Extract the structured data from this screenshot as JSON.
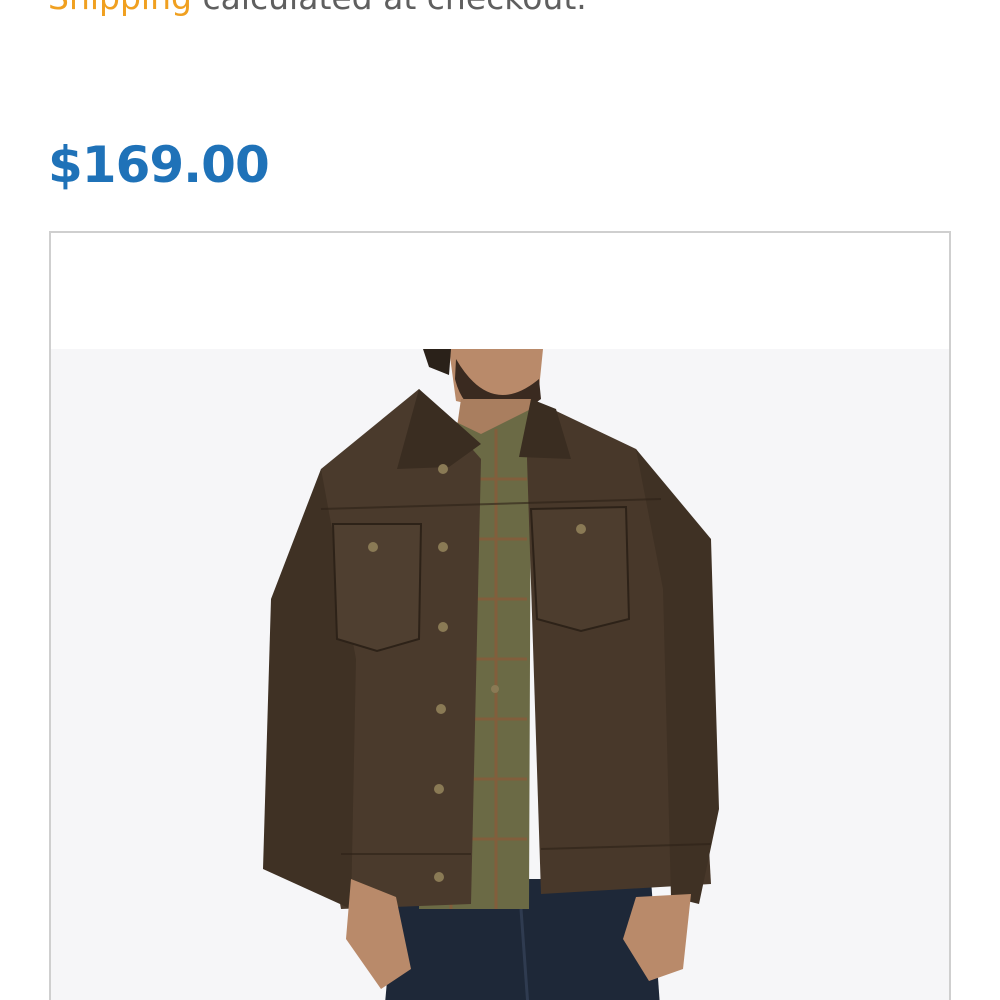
{
  "shipping": {
    "link_text": "Shipping",
    "rest_text": " calculated at checkout."
  },
  "product": {
    "price": "$169.00",
    "image_icon": "brown-waxed-canvas-trucker-jacket-photo"
  },
  "colors": {
    "price": "#1f72b8",
    "shipping_link": "#f0a020",
    "body_text": "#5f5f5f",
    "image_border": "#cfcfcf",
    "photo_background": "#f6f6f8",
    "jacket": "#4a3a2c"
  }
}
